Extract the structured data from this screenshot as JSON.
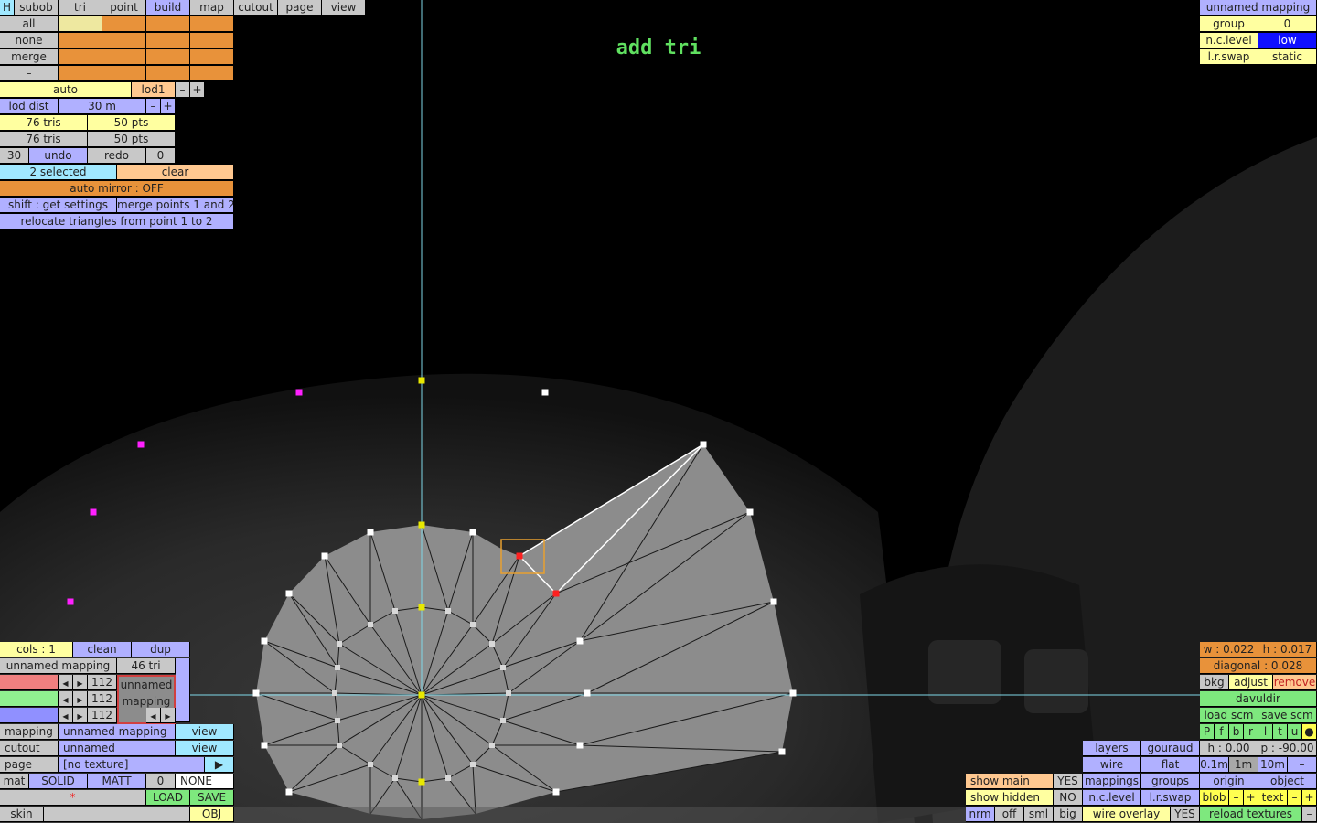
{
  "title": "add tri",
  "menu": {
    "h": "H",
    "subob": "subob",
    "tri": "tri",
    "point": "point",
    "build": "build",
    "map": "map",
    "cutout": "cutout",
    "page": "page",
    "view": "view"
  },
  "filters": {
    "all": "all",
    "none": "none",
    "merge": "merge",
    "dash": "–"
  },
  "lod": {
    "auto": "auto",
    "lod1": "lod1",
    "minus": "–",
    "plus": "+",
    "dist_label": "lod dist",
    "dist_value": "30 m"
  },
  "counts": {
    "tris1": "76 tris",
    "pts1": "50 pts",
    "tris2": "76 tris",
    "pts2": "50 pts"
  },
  "history": {
    "n": "30",
    "undo": "undo",
    "redo": "redo",
    "r": "0"
  },
  "selection": {
    "selected": "2 selected",
    "clear": "clear",
    "auto_mirror": "auto mirror : OFF",
    "shift": "shift : get settings",
    "merge_points": "merge points 1 and 2",
    "relocate": "relocate triangles from point 1 to 2"
  },
  "right_top": {
    "name": "unnamed mapping",
    "group": "group",
    "group_val": "0",
    "nclevel": "n.c.level",
    "nclevel_val": "low",
    "lrswap": "l.r.swap",
    "lrswap_val": "static"
  },
  "bottom_left": {
    "cols": "cols : 1",
    "clean": "clean",
    "dup": "dup",
    "mapping_name": "unnamed mapping",
    "tri_count": "46 tri",
    "rgb": [
      "112",
      "112",
      "112"
    ],
    "swatch": "unnamed mapping",
    "mapping": "mapping",
    "mapping_val": "unnamed mapping",
    "view1": "view",
    "cutout": "cutout",
    "cutout_val": "unnamed",
    "view2": "view",
    "page": "page",
    "page_val": "[no texture]",
    "play": "▶",
    "mat": "mat",
    "solid": "SOLID",
    "matt": "MATT",
    "mat_n": "0",
    "none": "NONE",
    "star": "*",
    "load": "LOAD",
    "save": "SAVE",
    "skin": "skin",
    "obj": "OBJ"
  },
  "bottom_right": {
    "w": "w : 0.022",
    "h": "h : 0.017",
    "diagonal": "diagonal : 0.028",
    "bkg": "bkg",
    "adjust": "adjust",
    "remove": "remove",
    "name": "davuldir",
    "load_scm": "load scm",
    "save_scm": "save scm",
    "flags": [
      "P",
      "f",
      "b",
      "r",
      "l",
      "t",
      "u",
      "●"
    ],
    "h0": "h : 0.00",
    "p": "p : -90.00",
    "d1": "0.1m",
    "d2": "1m",
    "d3": "10m",
    "dminus": "–",
    "origin": "origin",
    "object": "object",
    "blob": "blob",
    "bminus": "–",
    "bplus": "+",
    "text": "text",
    "tminus": "–",
    "tplus": "+",
    "reload": "reload textures",
    "rminus": "–",
    "layers": "layers",
    "gouraud": "gouraud",
    "wire": "wire",
    "flat": "flat",
    "mappings": "mappings",
    "groups": "groups",
    "ncl": "n.c.level",
    "lrs": "l.r.swap",
    "wire_overlay": "wire overlay",
    "yes2": "YES",
    "show_main": "show main",
    "yes1": "YES",
    "show_hidden": "show hidden",
    "no": "NO",
    "nrm": "nrm",
    "off": "off",
    "sml": "sml",
    "big": "big"
  },
  "colors": {
    "axis": "#7fd8e8",
    "mesh": "#8c8c8c",
    "yellow_pt": "#e8e800",
    "magenta_pt": "#ff20ff",
    "red_pt": "#ff2020",
    "title": "#60e060"
  }
}
